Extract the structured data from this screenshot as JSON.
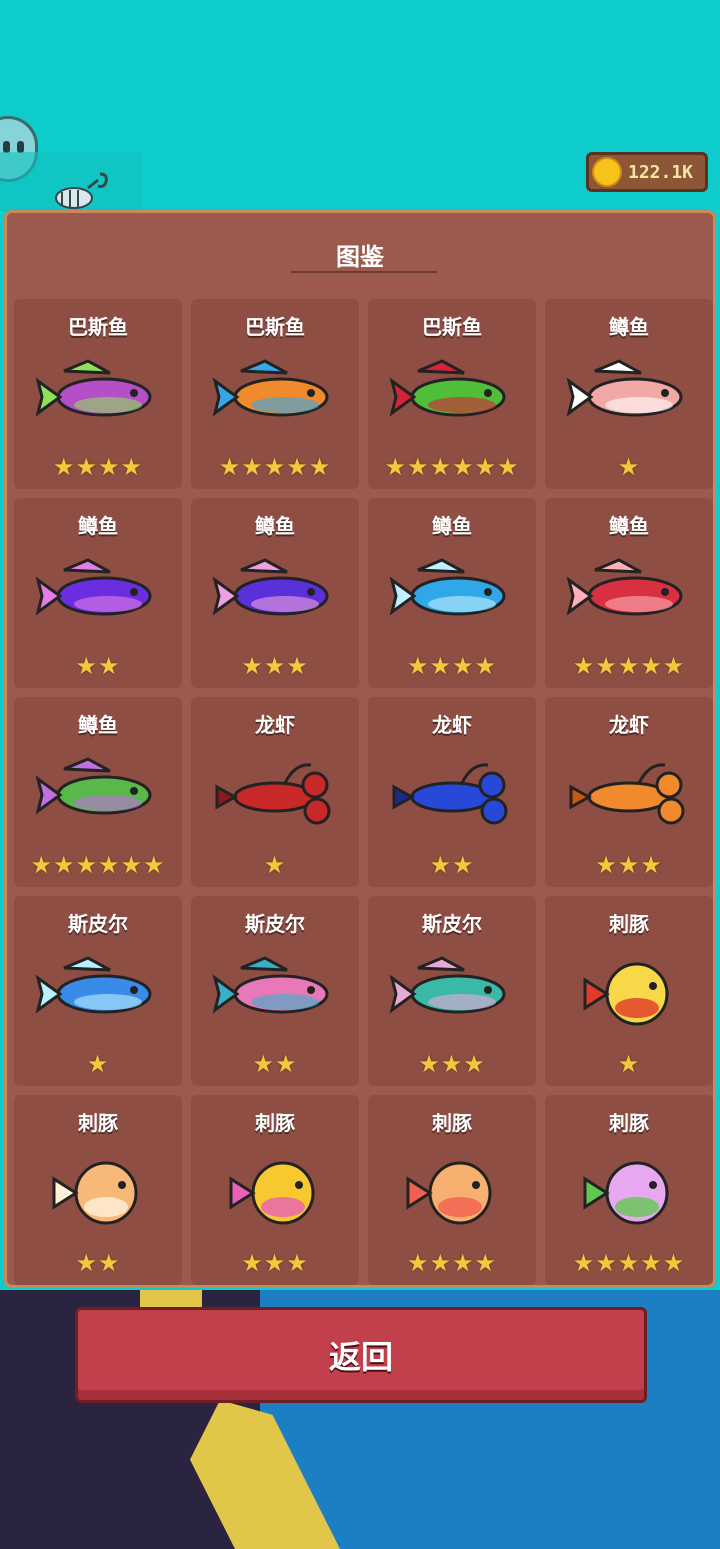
{
  "currency": {
    "coins": "122.1K",
    "icon": "coin-icon"
  },
  "panel": {
    "title": "图鉴"
  },
  "back_button": {
    "label": "返回"
  },
  "colors": {
    "panel": "#9c5a4e",
    "card": "#8f4e44",
    "star": "#f4c73f",
    "sky": "#0dcccb",
    "button": "#c2404b"
  },
  "cards": [
    {
      "name": "巴斯鱼",
      "stars": "★★★★",
      "body": "#b54ec9",
      "accent": "#8fe05a"
    },
    {
      "name": "巴斯鱼",
      "stars": "★★★★★",
      "body": "#f08a2c",
      "accent": "#36a8e8"
    },
    {
      "name": "巴斯鱼",
      "stars": "★★★★★★",
      "body": "#4fbf3a",
      "accent": "#d8223a"
    },
    {
      "name": "鳟鱼",
      "stars": "★",
      "body": "#f2a8a4",
      "accent": "#ffffff"
    },
    {
      "name": "鳟鱼",
      "stars": "★★",
      "body": "#6a2ee0",
      "accent": "#e47de8"
    },
    {
      "name": "鳟鱼",
      "stars": "★★★",
      "body": "#5a30d8",
      "accent": "#f0a0e0"
    },
    {
      "name": "鳟鱼",
      "stars": "★★★★",
      "body": "#30a8e8",
      "accent": "#bff0ff"
    },
    {
      "name": "鳟鱼",
      "stars": "★★★★★",
      "body": "#d83040",
      "accent": "#ffb0b8"
    },
    {
      "name": "鳟鱼",
      "stars": "★★★★★★",
      "body": "#5ab84a",
      "accent": "#c070e0"
    },
    {
      "name": "龙虾",
      "stars": "★",
      "body": "#c82828",
      "accent": "#8a1a1a"
    },
    {
      "name": "龙虾",
      "stars": "★★",
      "body": "#2848d8",
      "accent": "#1a2a8a"
    },
    {
      "name": "龙虾",
      "stars": "★★★",
      "body": "#f08a2c",
      "accent": "#c85a10"
    },
    {
      "name": "斯皮尔",
      "stars": "★",
      "body": "#3a8ae8",
      "accent": "#b8f0ff"
    },
    {
      "name": "斯皮尔",
      "stars": "★★",
      "body": "#e878b8",
      "accent": "#3ab0c8"
    },
    {
      "name": "斯皮尔",
      "stars": "★★★",
      "body": "#3ab8a8",
      "accent": "#e8a8d8"
    },
    {
      "name": "刺豚",
      "stars": "★",
      "body": "#f8d848",
      "accent": "#e03a2a"
    },
    {
      "name": "刺豚",
      "stars": "★★",
      "body": "#f8b878",
      "accent": "#fff0d8"
    },
    {
      "name": "刺豚",
      "stars": "★★★",
      "body": "#f8c830",
      "accent": "#e860b8"
    },
    {
      "name": "刺豚",
      "stars": "★★★★",
      "body": "#f8b070",
      "accent": "#f06050"
    },
    {
      "name": "刺豚",
      "stars": "★★★★★",
      "body": "#e8a8f0",
      "accent": "#60c850"
    }
  ]
}
